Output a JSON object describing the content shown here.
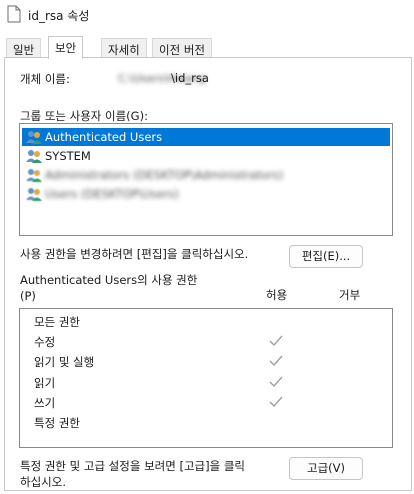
{
  "window": {
    "title": "id_rsa 속성"
  },
  "tabs": [
    {
      "label": "일반",
      "active": false
    },
    {
      "label": "보안",
      "active": true
    },
    {
      "label": "자세히",
      "active": false
    },
    {
      "label": "이전 버전",
      "active": false
    }
  ],
  "object": {
    "label": "개체 이름:",
    "value_blurred": "C:\\Users\\Hwang",
    "value_suffix": "\\id_rsa"
  },
  "groups": {
    "label": "그룹 또는 사용자 이름(G):",
    "items": [
      {
        "name": "Authenticated Users",
        "selected": true,
        "blurred": false
      },
      {
        "name": "SYSTEM",
        "selected": false,
        "blurred": false
      },
      {
        "name": "Administrators (DESKTOP\\Administrators)",
        "selected": false,
        "blurred": true
      },
      {
        "name": "Users (DESKTOP\\Users)",
        "selected": false,
        "blurred": true
      }
    ]
  },
  "edit": {
    "hint": "사용 권한을 변경하려면 [편집]을 클릭하십시오.",
    "button_label": "편집(E)..."
  },
  "permissions": {
    "title": "Authenticated Users의 사용 권한",
    "title_suffix": "(P)",
    "allow_header": "허용",
    "deny_header": "거부",
    "rows": [
      {
        "name": "모든 권한",
        "allow": false,
        "deny": false
      },
      {
        "name": "수정",
        "allow": true,
        "deny": false
      },
      {
        "name": "읽기 및 실행",
        "allow": true,
        "deny": false
      },
      {
        "name": "읽기",
        "allow": true,
        "deny": false
      },
      {
        "name": "쓰기",
        "allow": true,
        "deny": false
      },
      {
        "name": "특정 권한",
        "allow": false,
        "deny": false
      }
    ]
  },
  "advanced": {
    "hint_line1": "특정 권한 및 고급 설정을 보려면 [고급]을 클릭",
    "hint_line2": "하십시오.",
    "button_label": "고급(V)"
  },
  "colors": {
    "selection": "#0078d7",
    "check_gray": "#a0a0a0"
  },
  "icons": {
    "title": "document-icon",
    "user": "user-group-icon",
    "check": "checkmark-icon"
  }
}
